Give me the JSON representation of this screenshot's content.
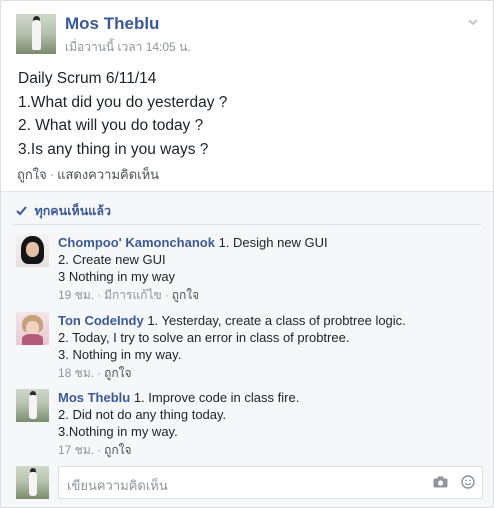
{
  "post": {
    "author": "Mos Theblu",
    "timestamp": "เมื่อวานนี้ เวลา 14:05 น.",
    "body_lines": [
      "Daily Scrum 6/11/14",
      "1.What did you do yesterday ?",
      "2. What will you do today ?",
      "3.Is any thing in you ways ?"
    ],
    "actions": {
      "like": "ถูกใจ",
      "separator": "·",
      "comment": "แสดงความคิดเห็น"
    },
    "menu_icon": "chevron-down-icon"
  },
  "seen": {
    "icon": "checkmark-icon",
    "label": "ทุกคนเห็นแล้ว"
  },
  "comments": [
    {
      "author": "Chompoo' Kamonchanok",
      "first_line": "1. Desigh new GUI",
      "lines": [
        "2. Create new GUI",
        "3 Nothing in my way"
      ],
      "time": "19 ชม.",
      "edited": "มีการแก้ไข",
      "like": "ถูกใจ"
    },
    {
      "author": "Ton CodeIndy",
      "first_line": "1. Yesterday, create a class of probtree logic.",
      "lines": [
        "2. Today, I try to solve an error in class of probtree.",
        "3. Nothing in my way."
      ],
      "time": "18 ชม.",
      "like": "ถูกใจ"
    },
    {
      "author": "Mos Theblu",
      "first_line": "1. Improve code in class fire.",
      "lines": [
        "2. Did not do any thing today.",
        "3.Nothing in my way."
      ],
      "time": "17 ชม.",
      "like": "ถูกใจ"
    }
  ],
  "composer": {
    "placeholder": "เขียนความคิดเห็น",
    "camera_icon": "camera-icon",
    "emoji_icon": "emoji-icon"
  },
  "colors": {
    "link_blue": "#3b5998",
    "meta_gray": "#90949c",
    "comments_bg": "#f6f7f9"
  }
}
